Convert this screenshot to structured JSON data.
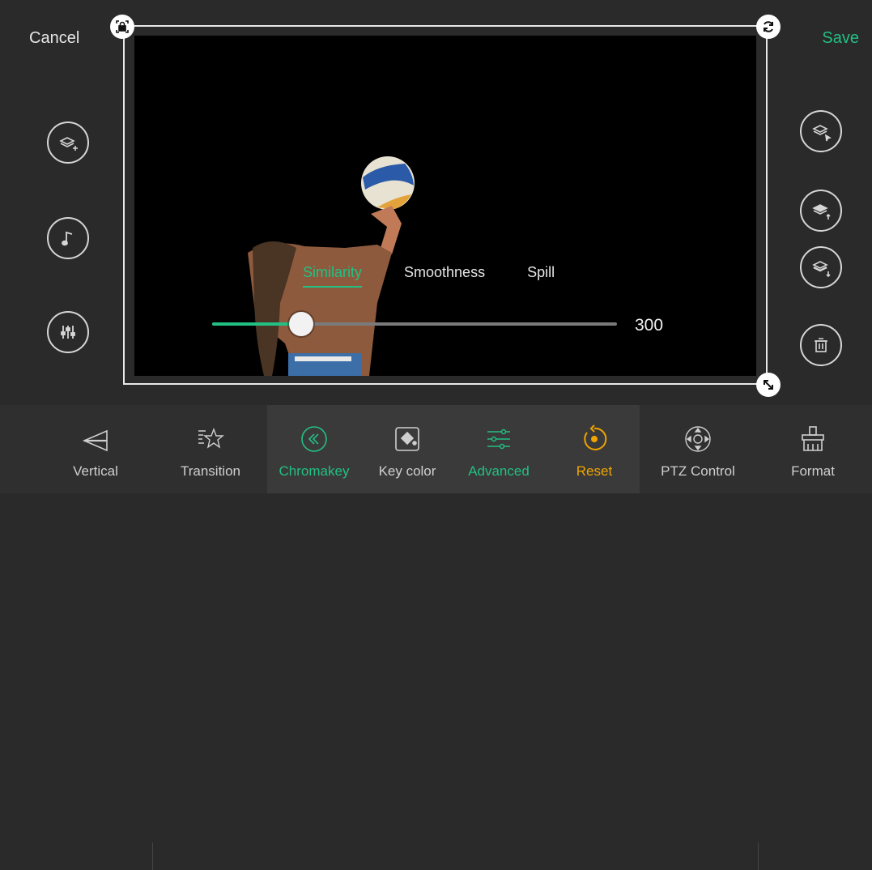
{
  "header": {
    "cancel_label": "Cancel",
    "save_label": "Save"
  },
  "overlay": {
    "tabs": [
      {
        "label": "Similarity",
        "active": true
      },
      {
        "label": "Smoothness",
        "active": false
      },
      {
        "label": "Spill",
        "active": false
      }
    ],
    "slider": {
      "value": "300",
      "fraction": 0.22
    }
  },
  "toolbar": {
    "items": [
      {
        "label": "Vertical",
        "icon": "vertical-flip-icon"
      },
      {
        "label": "Transition",
        "icon": "transition-star-icon"
      },
      {
        "label": "Chromakey",
        "icon": "chromakey-icon"
      },
      {
        "label": "Key color",
        "icon": "key-color-icon"
      },
      {
        "label": "Advanced",
        "icon": "advanced-sliders-icon"
      },
      {
        "label": "Reset",
        "icon": "reset-icon"
      },
      {
        "label": "PTZ Control",
        "icon": "ptz-control-icon"
      },
      {
        "label": "Format",
        "icon": "format-brush-icon"
      }
    ]
  },
  "colors": {
    "accent": "#22c083",
    "reset": "#f0a500",
    "background": "#2a2a2a"
  }
}
